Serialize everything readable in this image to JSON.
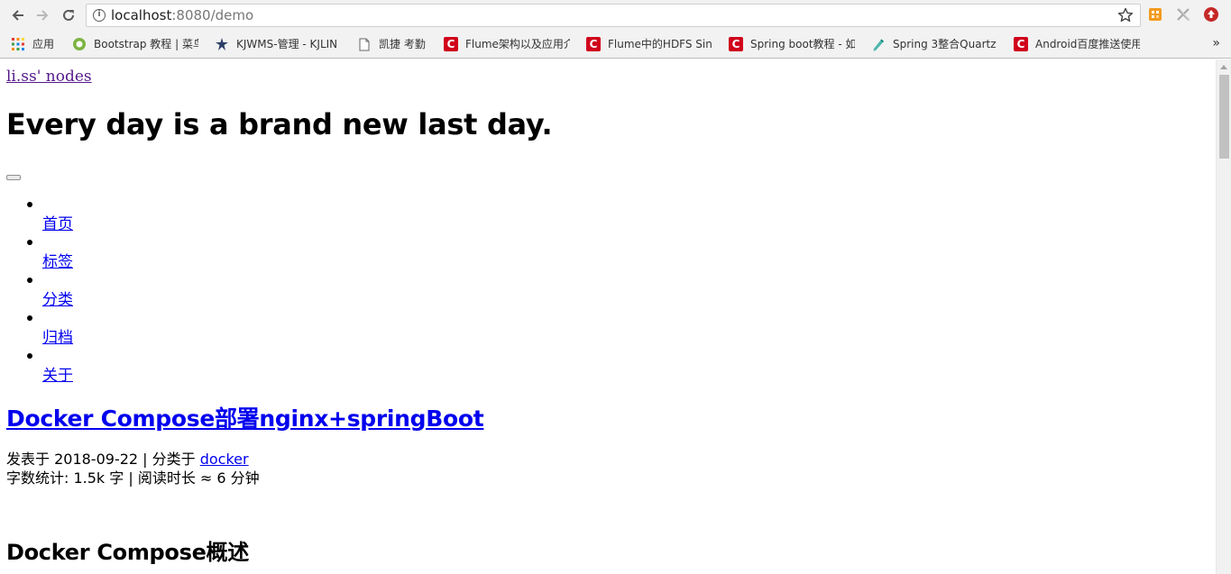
{
  "browser": {
    "url_host": "localhost",
    "url_rest": ":8080/demo",
    "info_glyph": "i",
    "more_bookmarks": "»",
    "bookmarks": [
      {
        "label": "应用",
        "icon": "apps-grid-icon"
      },
      {
        "label": "Bootstrap 教程 | 菜鸟",
        "icon": "runoob-icon"
      },
      {
        "label": "KJWMS-管理 - KJLIN",
        "icon": "kjwms-icon"
      },
      {
        "label": "凯捷 考勤",
        "icon": "page-icon"
      },
      {
        "label": "Flume架构以及应用介",
        "icon": "csdn-icon"
      },
      {
        "label": "Flume中的HDFS Sin",
        "icon": "csdn-icon"
      },
      {
        "label": "Spring boot教程 - 如",
        "icon": "csdn-icon"
      },
      {
        "label": "Spring 3整合Quartz",
        "icon": "pen-icon"
      },
      {
        "label": "Android百度推送使用",
        "icon": "csdn-icon"
      }
    ],
    "colors": {
      "csdn": "#d0021b",
      "extension_orange": "#f29a1e",
      "extension_red": "#c62828"
    }
  },
  "page": {
    "site_link": "li.ss' nodes",
    "site_title": "Every day is a brand new last day.",
    "menu": [
      "首页",
      "标签",
      "分类",
      "归档",
      "关于"
    ],
    "post": {
      "title": "Docker Compose部署nginx+springBoot",
      "meta_prefix": "发表于 2018-09-22 | 分类于 ",
      "category": "docker",
      "stats": "字数统计: 1.5k 字 | 阅读时长 ≈ 6 分钟",
      "section_heading": "Docker Compose概述"
    },
    "colors": {
      "link": "#0000ee",
      "visited_link": "#551a8b"
    }
  }
}
